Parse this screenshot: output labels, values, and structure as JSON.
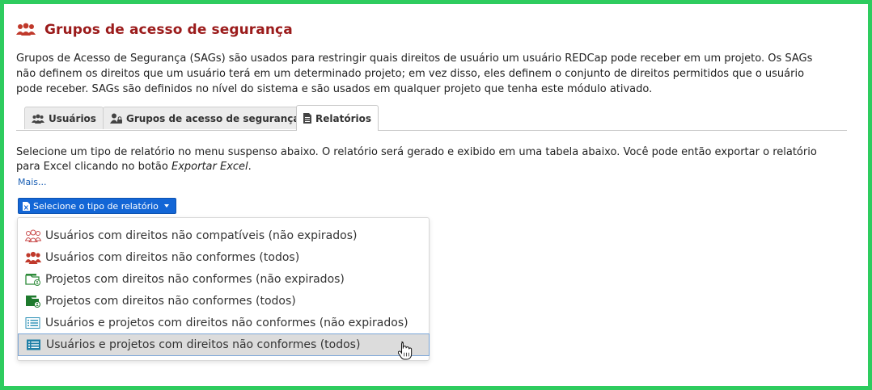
{
  "page": {
    "title": "Grupos de acesso de segurança",
    "intro": "Grupos de Acesso de Segurança (SAGs) são usados para restringir quais direitos de usuário um usuário REDCap pode receber em um projeto. Os SAGs não definem os direitos que um usuário terá em um determinado projeto; em vez disso, eles definem o conjunto de direitos permitidos que o usuário pode receber. SAGs são definidos no nível do sistema e são usados em qualquer projeto que tenha este módulo ativado."
  },
  "tabs": [
    {
      "label": "Usuários",
      "icon": "users-icon"
    },
    {
      "label": "Grupos de acesso de segurança",
      "icon": "user-lock-icon"
    },
    {
      "label": "Relatórios",
      "icon": "file-icon",
      "active": true
    }
  ],
  "reports": {
    "description_start": "Selecione um tipo de relatório no menu suspenso abaixo. O relatório será gerado e exibido em uma tabela abaixo. Você pode então exportar o relatório para Excel clicando no botão ",
    "description_emphasis": "Exportar Excel",
    "description_end": ".",
    "more_link": "Mais...",
    "dropdown_label": "Selecione o tipo de relatório",
    "options": [
      {
        "label": "Usuários com direitos não compatíveis (não expirados)",
        "icon": "users-outline-icon",
        "color": "#c94b4b"
      },
      {
        "label": "Usuários com direitos não conformes (todos)",
        "icon": "users-icon",
        "color": "#c0392b"
      },
      {
        "label": "Projetos com direitos não conformes (não expirados)",
        "icon": "folder-outline-icon",
        "color": "#2e8b3a"
      },
      {
        "label": "Projetos com direitos não conformes (todos)",
        "icon": "folder-icon",
        "color": "#1e7a2d"
      },
      {
        "label": "Usuários e projetos com direitos não conformes (não expirados)",
        "icon": "list-outline-icon",
        "color": "#2a8fb5"
      },
      {
        "label": "Usuários e projetos com direitos não conformes (todos)",
        "icon": "list-icon",
        "color": "#1f7fa6",
        "hovered": true
      }
    ]
  },
  "colors": {
    "title": "#9b1b1b",
    "button": "#1366d6",
    "frame": "#2ecc5f"
  }
}
